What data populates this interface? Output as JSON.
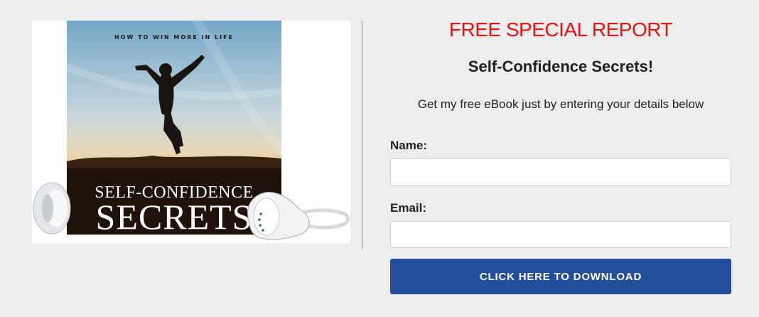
{
  "product": {
    "cover_tagline": "HOW TO WIN MORE IN LIFE",
    "cover_title_line1": "SELF-CONFIDENCE",
    "cover_title_line2": "SECRETS"
  },
  "offer": {
    "heading": "FREE SPECIAL REPORT",
    "title": "Self-Confidence Secrets!",
    "subtitle": "Get my free eBook just by entering your details below",
    "heading_color": "#ee1111"
  },
  "form": {
    "name_label": "Name:",
    "name_value": "",
    "name_placeholder": "",
    "email_label": "Email:",
    "email_value": "",
    "email_placeholder": "",
    "submit_label": "CLICK HERE TO DOWNLOAD",
    "submit_color": "#234e9b"
  }
}
